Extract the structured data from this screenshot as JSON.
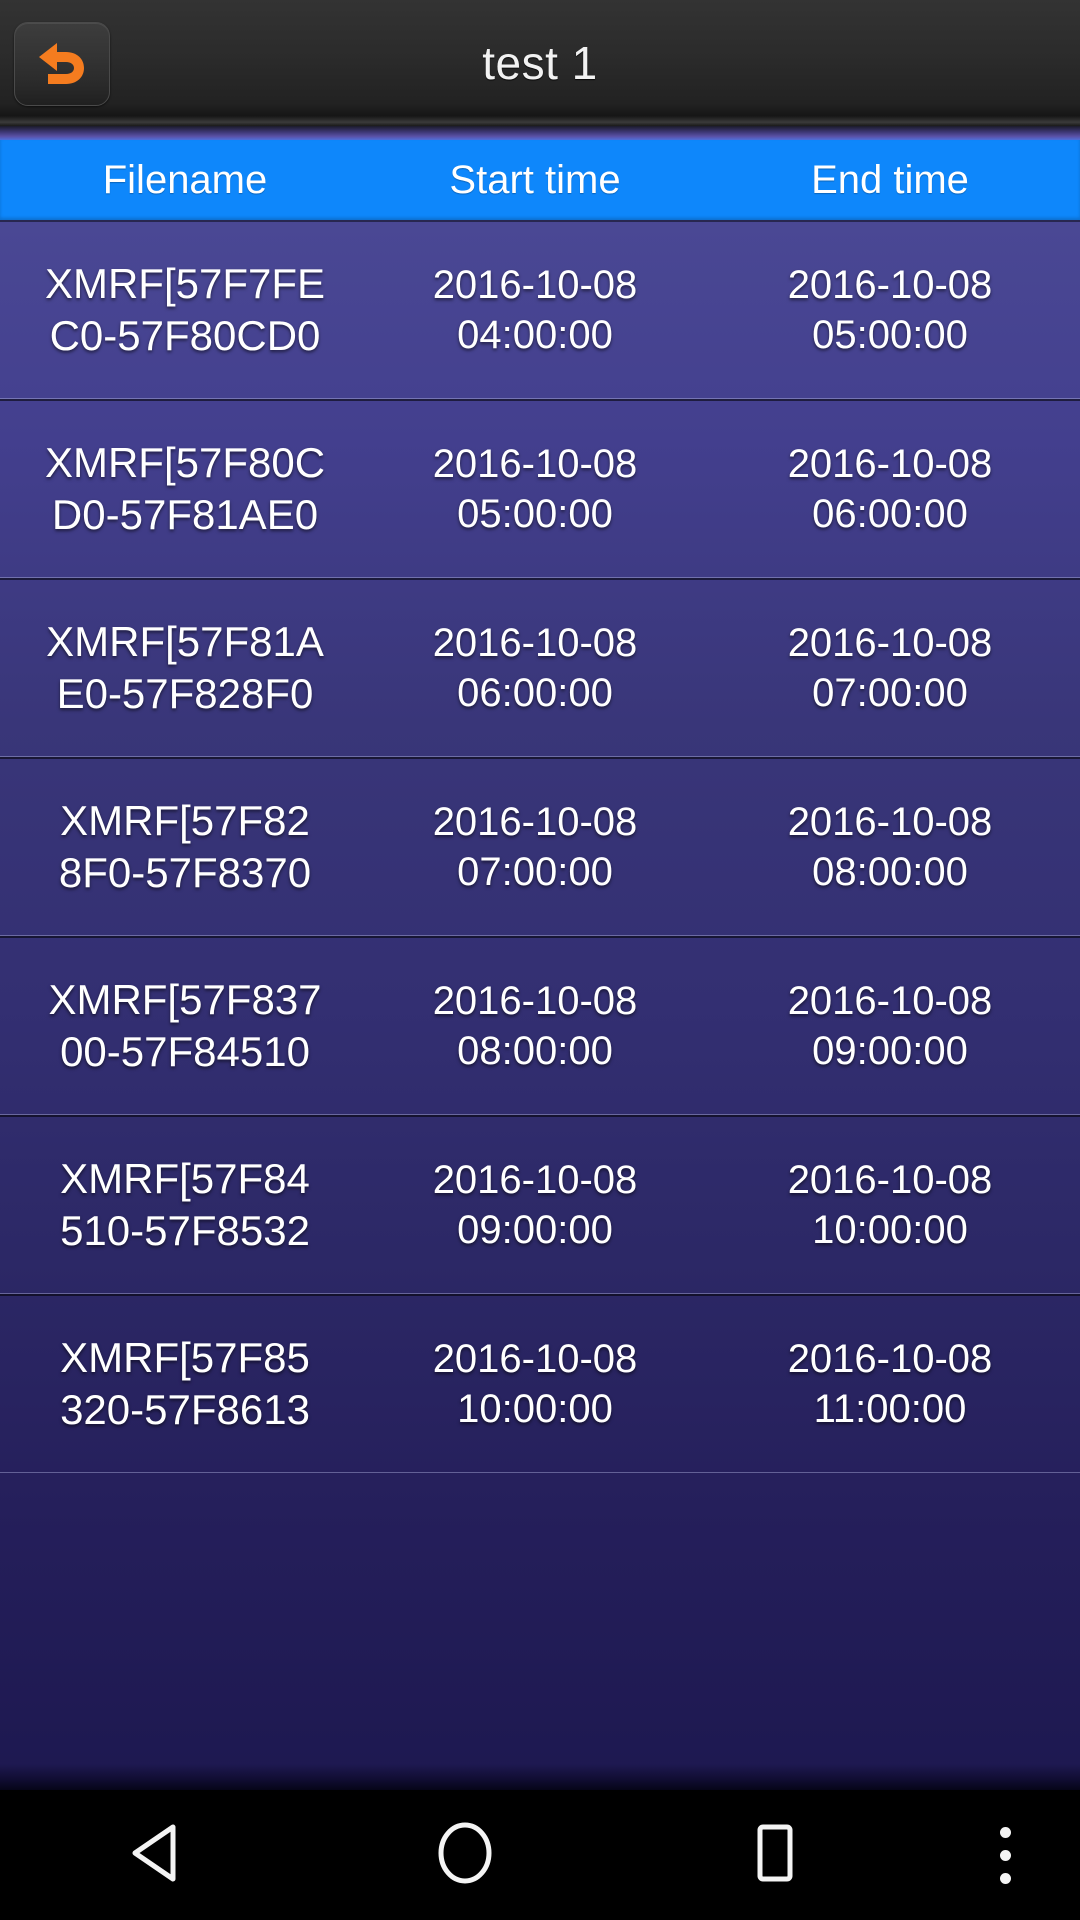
{
  "titlebar": {
    "title": "test 1",
    "back_icon": "undo-back-arrow-icon",
    "back_icon_color": "#F57C1F"
  },
  "table": {
    "header_bg": "#0E87FB",
    "columns": [
      {
        "key": "filename",
        "label": "Filename"
      },
      {
        "key": "start_time",
        "label": "Start time"
      },
      {
        "key": "end_time",
        "label": "End time"
      }
    ],
    "rows": [
      {
        "filename": "XMRF[57F7FE\nC0-57F80CD0",
        "start_time": "2016-10-08\n04:00:00",
        "end_time": "2016-10-08\n05:00:00"
      },
      {
        "filename": "XMRF[57F80C\nD0-57F81AE0",
        "start_time": "2016-10-08\n05:00:00",
        "end_time": "2016-10-08\n06:00:00"
      },
      {
        "filename": "XMRF[57F81A\nE0-57F828F0",
        "start_time": "2016-10-08\n06:00:00",
        "end_time": "2016-10-08\n07:00:00"
      },
      {
        "filename": "XMRF[57F82\n8F0-57F8370",
        "start_time": "2016-10-08\n07:00:00",
        "end_time": "2016-10-08\n08:00:00"
      },
      {
        "filename": "XMRF[57F837\n00-57F84510",
        "start_time": "2016-10-08\n08:00:00",
        "end_time": "2016-10-08\n09:00:00"
      },
      {
        "filename": "XMRF[57F84\n510-57F8532",
        "start_time": "2016-10-08\n09:00:00",
        "end_time": "2016-10-08\n10:00:00"
      },
      {
        "filename": "XMRF[57F85\n320-57F8613",
        "start_time": "2016-10-08\n10:00:00",
        "end_time": "2016-10-08\n11:00:00"
      }
    ]
  },
  "navbar": {
    "back": "triangle-back-icon",
    "home": "circle-home-icon",
    "recents": "square-recents-icon",
    "overflow": "three-dot-overflow-icon"
  }
}
